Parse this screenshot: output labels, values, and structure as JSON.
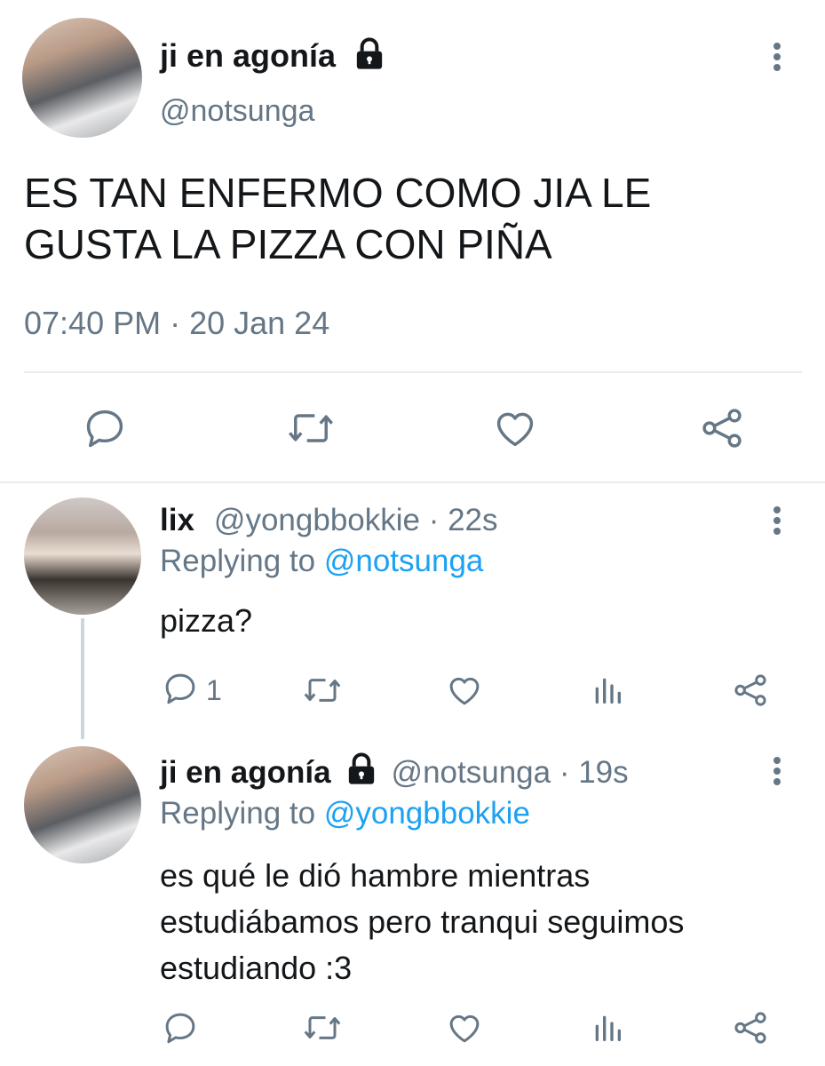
{
  "main_tweet": {
    "display_name": "ji en agonía",
    "handle": "@notsunga",
    "text_line1": "ES TAN ENFERMO COMO JIA LE",
    "text_line2": "GUSTA LA PIZZA CON PIÑA",
    "time": "07:40 PM",
    "separator": "·",
    "date": "20 Jan 24",
    "icons": {
      "lock": "lock-icon",
      "more": "more-icon",
      "reply": "reply-icon",
      "retweet": "retweet-icon",
      "like": "like-icon",
      "share": "share-icon"
    }
  },
  "replies": [
    {
      "display_name": "lix",
      "handle_time": "@yongbbokkie · 22s",
      "replying_prefix": "Replying to",
      "replying_handle": "@notsunga",
      "text": "pizza?",
      "reply_count": "1"
    },
    {
      "display_name": "ji en agonía",
      "handle_time": "@notsunga · 19s",
      "replying_prefix": "Replying to",
      "replying_handle": "@yongbbokkie",
      "text_line1": "es qué le dió hambre mientras",
      "text_line2": "estudiábamos pero tranqui seguimos",
      "text_line3": "estudiando :3",
      "reply_count": ""
    }
  ],
  "colors": {
    "text": "#14171a",
    "secondary": "#657786",
    "link": "#1da1f2",
    "divider": "#e6ecf0"
  }
}
